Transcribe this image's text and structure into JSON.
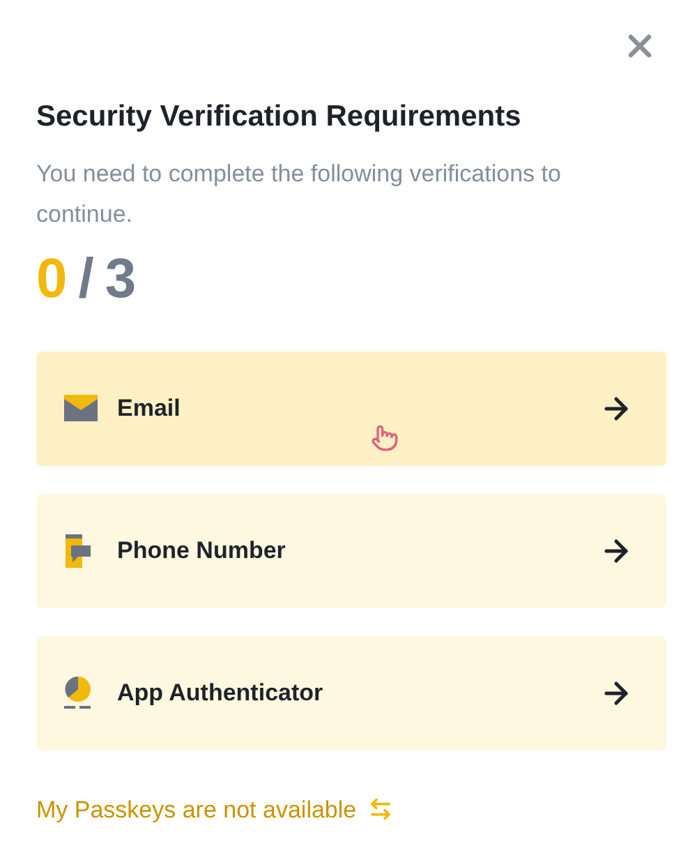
{
  "dialog": {
    "title": "Security Verification Requirements",
    "description": "You need to complete the following verifications to continue.",
    "progress": {
      "done": "0",
      "separator": "/",
      "total": "3"
    },
    "methods": [
      {
        "kind": "email",
        "label": "Email",
        "hovered": true
      },
      {
        "kind": "phone",
        "label": "Phone Number",
        "hovered": false
      },
      {
        "kind": "authenticator",
        "label": "App Authenticator",
        "hovered": false
      }
    ],
    "footer_link": "My Passkeys are not available"
  }
}
